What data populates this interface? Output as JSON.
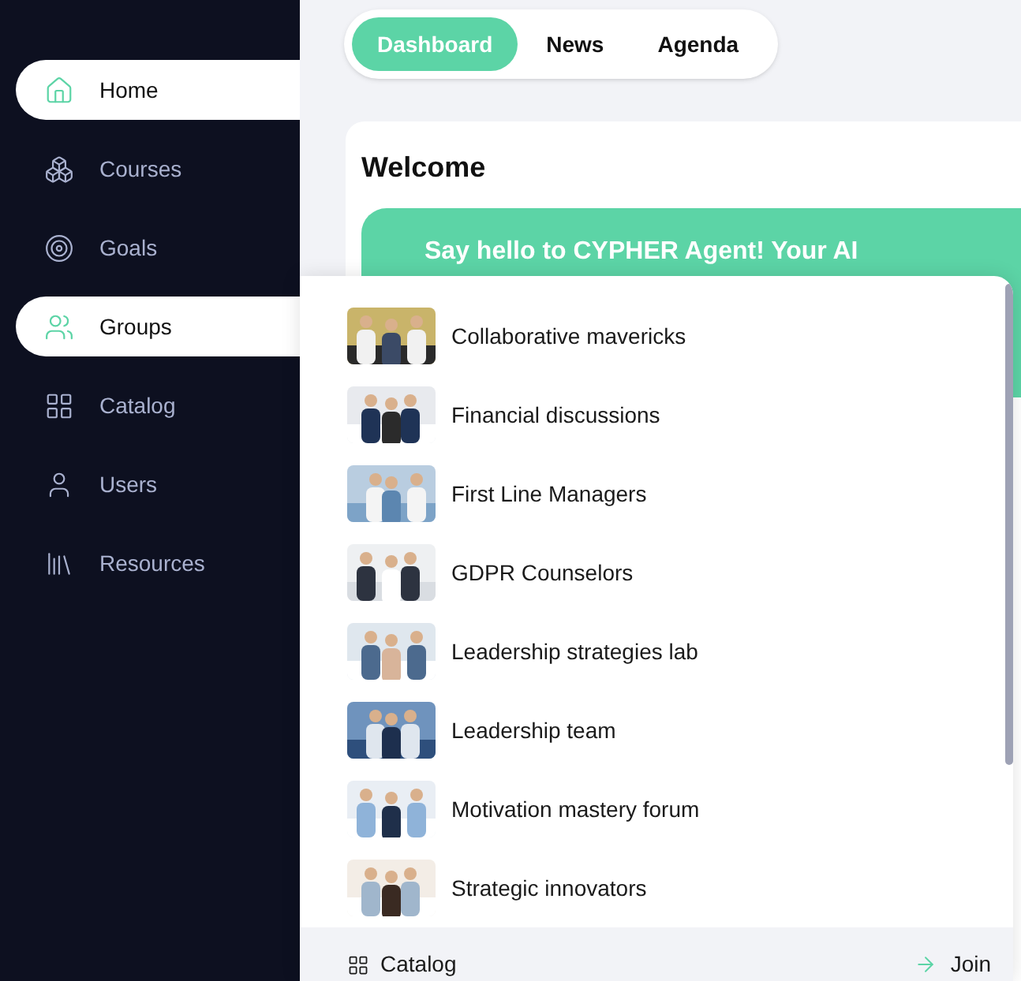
{
  "sidebar": {
    "items": [
      {
        "label": "Home",
        "selected": true
      },
      {
        "label": "Courses",
        "selected": false
      },
      {
        "label": "Goals",
        "selected": false
      },
      {
        "label": "Groups",
        "selected": true
      },
      {
        "label": "Catalog",
        "selected": false
      },
      {
        "label": "Users",
        "selected": false
      },
      {
        "label": "Resources",
        "selected": false
      }
    ]
  },
  "tabs": [
    {
      "label": "Dashboard",
      "selected": true
    },
    {
      "label": "News",
      "selected": false
    },
    {
      "label": "Agenda",
      "selected": false
    }
  ],
  "welcome": {
    "title": "Welcome",
    "banner": "Say hello to CYPHER Agent! Your AI"
  },
  "groups_menu": {
    "items": [
      {
        "name": "Collaborative mavericks",
        "kind": "picture"
      },
      {
        "name": "Financial discussions",
        "kind": "picture"
      },
      {
        "name": "First Line Managers",
        "kind": "picture"
      },
      {
        "name": "GDPR Counselors",
        "kind": "picture"
      },
      {
        "name": "Leadership strategies lab",
        "kind": "picture"
      },
      {
        "name": "Leadership team",
        "kind": "picture"
      },
      {
        "name": "Motivation mastery forum",
        "kind": "picture"
      },
      {
        "name": "Strategic innovators",
        "kind": "picture"
      }
    ],
    "footer": {
      "catalog": "Catalog",
      "join": "Join"
    }
  }
}
